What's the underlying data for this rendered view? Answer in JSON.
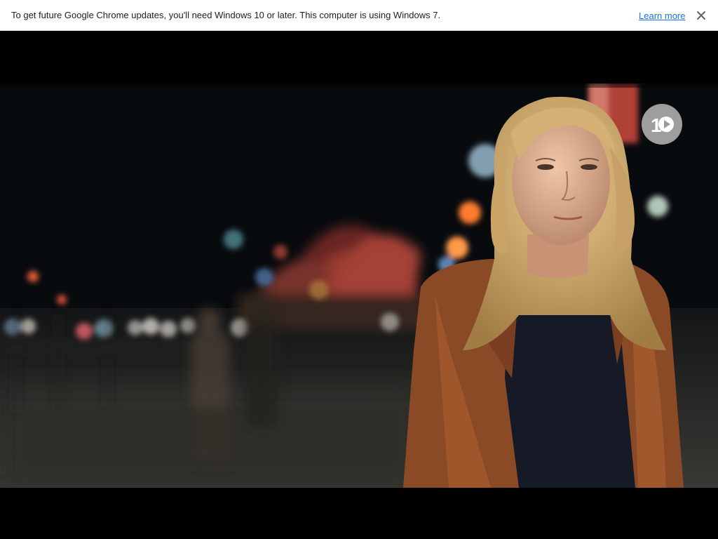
{
  "infobar": {
    "message": "To get future Google Chrome updates, you'll need Windows 10 or later. This computer is using Windows 7.",
    "learn_more": "Learn more",
    "close_icon": "close-icon"
  },
  "player": {
    "logo_icon": "channel-10-play-logo",
    "logo_text": "10"
  }
}
